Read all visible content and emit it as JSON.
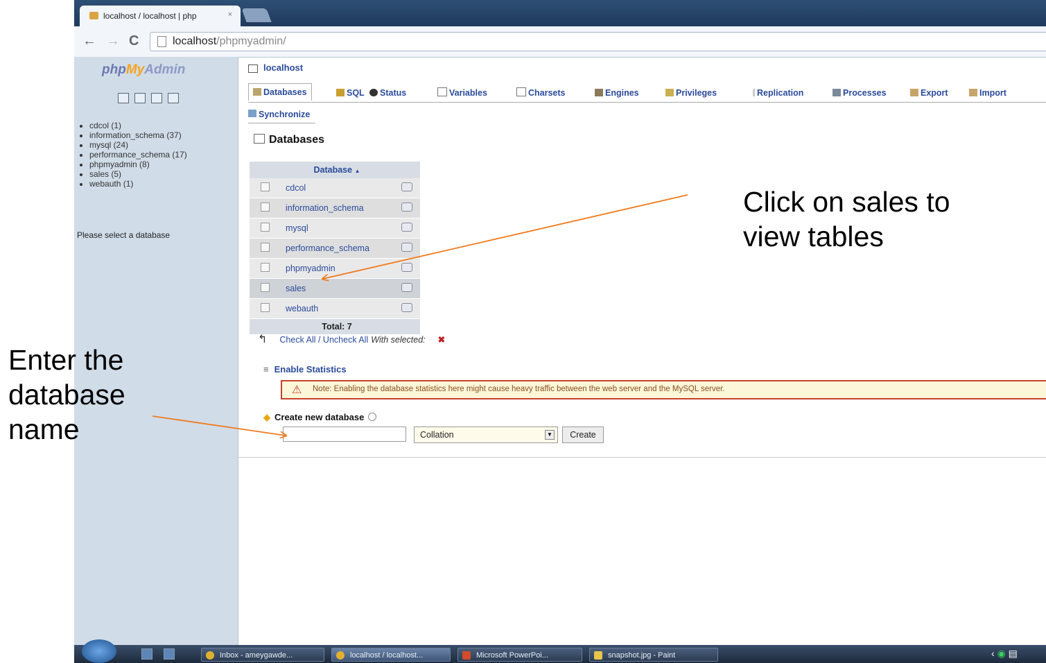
{
  "browser": {
    "tab_title": "localhost / localhost | php",
    "tab_close": "×",
    "url_host": "localhost",
    "url_path": "/phpmyadmin/"
  },
  "sidebar": {
    "logo_php": "php",
    "logo_my": "My",
    "logo_admin": "Admin",
    "databases": [
      "cdcol (1)",
      "information_schema (37)",
      "mysql (24)",
      "performance_schema (17)",
      "phpmyadmin (8)",
      "sales (5)",
      "webauth (1)"
    ],
    "prompt": "Please select a database"
  },
  "server": {
    "name": "localhost"
  },
  "tabs": [
    "Databases",
    "SQL",
    "Status",
    "Variables",
    "Charsets",
    "Engines",
    "Privileges",
    "Replication",
    "Processes",
    "Export",
    "Import"
  ],
  "sync_tab": "Synchronize",
  "main": {
    "heading": "Databases",
    "table_header": "Database",
    "sort_indicator": "▲",
    "rows": [
      "cdcol",
      "information_schema",
      "mysql",
      "performance_schema",
      "phpmyadmin",
      "sales",
      "webauth"
    ],
    "total": "Total: 7",
    "check_all": "Check All / Uncheck All",
    "with_selected": "With selected:",
    "enable_statistics": "Enable Statistics",
    "note": "Note: Enabling the database statistics here might cause heavy traffic between the web server and the MySQL server.",
    "create_label": "Create new database",
    "collation": "Collation",
    "create_button": "Create"
  },
  "annotations": {
    "right": [
      "Click on sales to",
      "view tables"
    ],
    "left": [
      "Enter the",
      "database",
      "name"
    ],
    "arrow_color": "#f07a1c"
  },
  "taskbar": {
    "items": [
      "Inbox - ameygawde...",
      "localhost / localhost...",
      "Microsoft PowerPoi...",
      "snapshot.jpg - Paint"
    ]
  }
}
